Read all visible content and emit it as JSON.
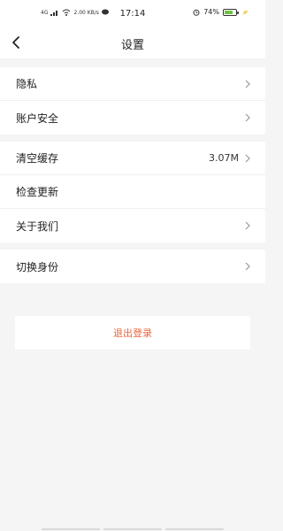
{
  "status_bar": {
    "network_left": "4G",
    "speed": "2.00 KB/s",
    "time": "17:14",
    "battery_percent": "74%",
    "battery_level": 0.74,
    "battery_color": "#6cc43f"
  },
  "nav": {
    "title": "设置"
  },
  "groups": [
    {
      "rows": [
        {
          "label": "隐私",
          "value": "",
          "chevron": true
        },
        {
          "label": "账户安全",
          "value": "",
          "chevron": true
        }
      ]
    },
    {
      "rows": [
        {
          "label": "清空缓存",
          "value": "3.07M",
          "chevron": true
        },
        {
          "label": "检查更新",
          "value": "",
          "chevron": false
        },
        {
          "label": "关于我们",
          "value": "",
          "chevron": true
        }
      ]
    },
    {
      "rows": [
        {
          "label": "切换身份",
          "value": "",
          "chevron": true
        }
      ]
    }
  ],
  "logout": {
    "label": "退出登录",
    "color": "#e8663c"
  },
  "icons": {
    "back": "back-arrow-icon",
    "chevron": "chevron-right-icon"
  }
}
